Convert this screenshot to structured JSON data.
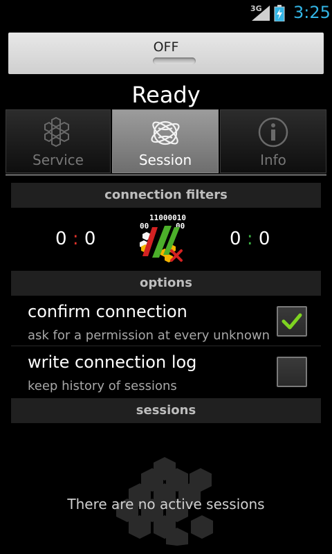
{
  "statusbar": {
    "network": "3G",
    "time": "3:25"
  },
  "toggle": {
    "label": "OFF"
  },
  "status_title": "Ready",
  "tabs": [
    {
      "label": "Service",
      "icon": "hexagon-cluster-icon",
      "active": false
    },
    {
      "label": "Session",
      "icon": "globe-icon",
      "active": true
    },
    {
      "label": "Info",
      "icon": "info-icon",
      "active": false
    }
  ],
  "connection_filters": {
    "header": "connection filters",
    "left_counter": {
      "a": "0",
      "sep": ":",
      "b": "0"
    },
    "right_counter": {
      "a": "0",
      "sep": ":",
      "b": "0"
    },
    "center_icon_text": [
      "11000010",
      "00",
      "00"
    ]
  },
  "options": {
    "header": "options",
    "items": [
      {
        "title": "confirm connection",
        "subtitle": "ask for a permission at every unknown",
        "checked": true
      },
      {
        "title": "write connection log",
        "subtitle": "keep history of sessions",
        "checked": false
      }
    ]
  },
  "sessions": {
    "header": "sessions",
    "empty_message": "There are no active sessions"
  },
  "colors": {
    "accent": "#33b5e5",
    "check": "#7ed321",
    "red": "#e0332a",
    "green": "#3cb043"
  }
}
